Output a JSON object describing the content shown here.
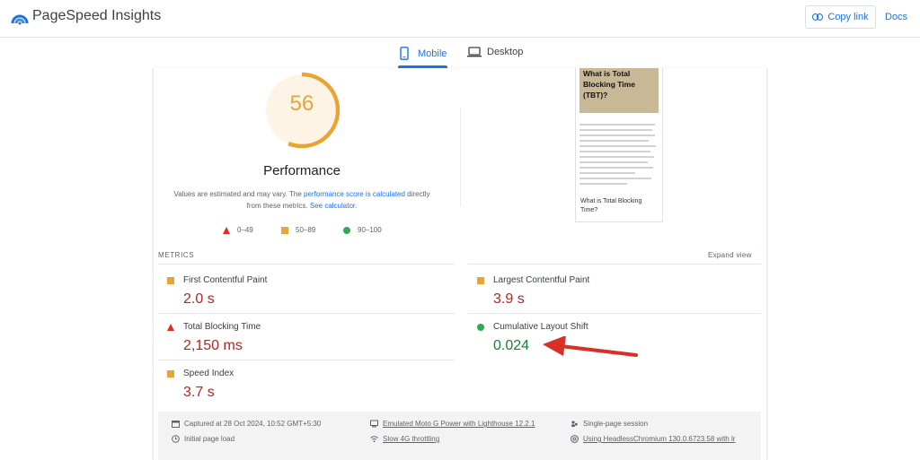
{
  "header": {
    "brand": "PageSpeed Insights",
    "copy_link": "Copy link",
    "docs": "Docs"
  },
  "tabs": [
    {
      "label": "Mobile",
      "active": true,
      "icon": "phone-icon"
    },
    {
      "label": "Desktop",
      "active": false,
      "icon": "laptop-icon"
    }
  ],
  "score": {
    "value": "56",
    "title": "Performance",
    "note_prefix": "Values are estimated and may vary. The ",
    "note_link1": "performance score is calculated",
    "note_mid": " directly from these metrics. ",
    "note_link2": "See calculator.",
    "legend": [
      {
        "label": "0–49",
        "shape": "triangle",
        "color": "#d93025"
      },
      {
        "label": "50–89",
        "shape": "square",
        "color": "#e8a435"
      },
      {
        "label": "90–100",
        "shape": "circle",
        "color": "#34a853"
      }
    ]
  },
  "screenshot": {
    "hero_text": "What is Total Blocking Time (TBT)?",
    "subheading": "What is Total Blocking Time?"
  },
  "metrics": {
    "label": "METRICS",
    "expand": "Expand view",
    "items": [
      {
        "name": "First Contentful Paint",
        "value": "2.0 s",
        "rating": "average"
      },
      {
        "name": "Largest Contentful Paint",
        "value": "3.9 s",
        "rating": "average"
      },
      {
        "name": "Total Blocking Time",
        "value": "2,150 ms",
        "rating": "poor"
      },
      {
        "name": "Cumulative Layout Shift",
        "value": "0.024",
        "rating": "good"
      },
      {
        "name": "Speed Index",
        "value": "3.7 s",
        "rating": "average"
      }
    ]
  },
  "footer": {
    "captured": "Captured at 28 Oct 2024, 10:52 GMT+5:30",
    "initial_load": "Initial page load",
    "device": "Emulated Moto G Power with Lighthouse 12.2.1",
    "throttling": "Slow 4G throttling",
    "session": "Single-page session",
    "browser": "Using HeadlessChromium 130.0.6723.58 with lr"
  },
  "colors": {
    "accent": "#1a73e8",
    "average": "#e8a435",
    "poor": "#d93025",
    "good": "#34a853",
    "annotation_arrow": "#d93025"
  }
}
